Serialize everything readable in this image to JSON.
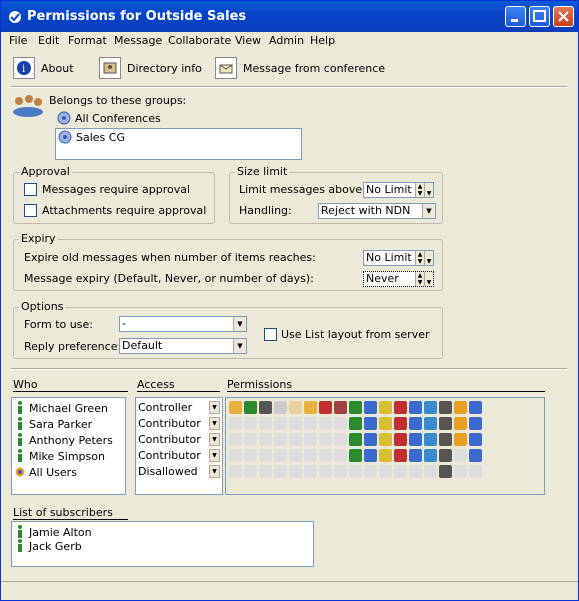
{
  "window": {
    "title": "Permissions for Outside Sales"
  },
  "menu": [
    "File",
    "Edit",
    "Format",
    "Message",
    "Collaborate",
    "View",
    "Admin",
    "Help"
  ],
  "toolbar": {
    "about": "About",
    "directory": "Directory info",
    "message": "Message from conference"
  },
  "groups": {
    "label": "Belongs to these groups:",
    "items": [
      "All Conferences",
      "Sales CG"
    ]
  },
  "approval": {
    "title": "Approval",
    "messages": "Messages require approval",
    "attachments": "Attachments require approval"
  },
  "sizelimit": {
    "title": "Size limit",
    "limit_label": "Limit messages above:",
    "limit_value": "No Limit",
    "handling_label": "Handling:",
    "handling_value": "Reject with NDN"
  },
  "expiry": {
    "title": "Expiry",
    "items_label": "Expire old messages when number of items reaches:",
    "items_value": "No Limit",
    "days_label": "Message expiry (Default, Never, or number of days):",
    "days_value": "Never"
  },
  "options": {
    "title": "Options",
    "form_label": "Form to use:",
    "form_value": "-",
    "reply_label": "Reply preference:",
    "reply_value": "Default",
    "list_layout": "Use List layout from server"
  },
  "table": {
    "who": "Who",
    "access": "Access",
    "permissions": "Permissions",
    "rows": [
      {
        "who": "Michael Green",
        "access": "Controller"
      },
      {
        "who": "Sara Parker",
        "access": "Contributor"
      },
      {
        "who": "Anthony Peters",
        "access": "Contributor"
      },
      {
        "who": "Mike Simpson",
        "access": "Contributor"
      },
      {
        "who": "All Users",
        "access": "Disallowed"
      }
    ]
  },
  "subscribers": {
    "title": "List of subscribers",
    "items": [
      "Jamie Alton",
      "Jack Gerb"
    ]
  },
  "colors": {
    "title_bar": "#0845c8",
    "face": "#ece9d8"
  }
}
